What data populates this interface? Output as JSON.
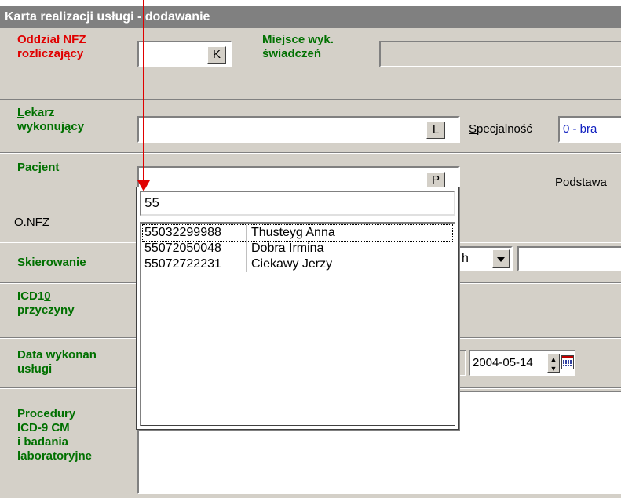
{
  "window": {
    "title": "Karta realizacji usługi - dodawanie"
  },
  "labels": {
    "oddzial_line1": "Oddział NFZ",
    "oddzial_line2": "rozliczający",
    "miejsce_line1": "Miejsce wyk.",
    "miejsce_line2": "świadczeń",
    "lekarz_first": "L",
    "lekarz_rest": "ekarz",
    "lekarz_line2": "wykonujący",
    "specjalnosc_first": "S",
    "specjalnosc_rest": "pecjalność",
    "pacjent": "Pacjent",
    "podstawa": "Podstawa",
    "onfz": "O.NFZ",
    "skierowanie_first": "S",
    "skierowanie_rest": "kierowanie",
    "icd10_a": "ICD1",
    "icd10_b": "0",
    "icd10_line2": "przyczyny",
    "data_line1": "Data wykonan",
    "data_line2": "usługi",
    "proc_line1": "Procedury",
    "proc_line2": "ICD-9 CM",
    "proc_line3": "i badania",
    "proc_line4": "laboratoryjne"
  },
  "buttons": {
    "k": "K",
    "l": "L",
    "p": "P"
  },
  "specjalnosc_value": "0 - bra",
  "skierowanie_partial": "h",
  "date_value": "2004-05-14",
  "dropdown": {
    "search_value": "55",
    "items": [
      {
        "id": "55032299988",
        "name": "Thusteyg Anna"
      },
      {
        "id": "55072050048",
        "name": "Dobra Irmina"
      },
      {
        "id": "55072722231",
        "name": "Ciekawy Jerzy"
      }
    ]
  },
  "colors": {
    "red_label": "#e00000",
    "green_label": "#007000",
    "arrow": "#e00000",
    "titlebar": "#808080"
  },
  "icons": [
    "down-arrow-annotation",
    "combo-dropdown-icon",
    "spin-updown-icon",
    "calendar-icon"
  ]
}
